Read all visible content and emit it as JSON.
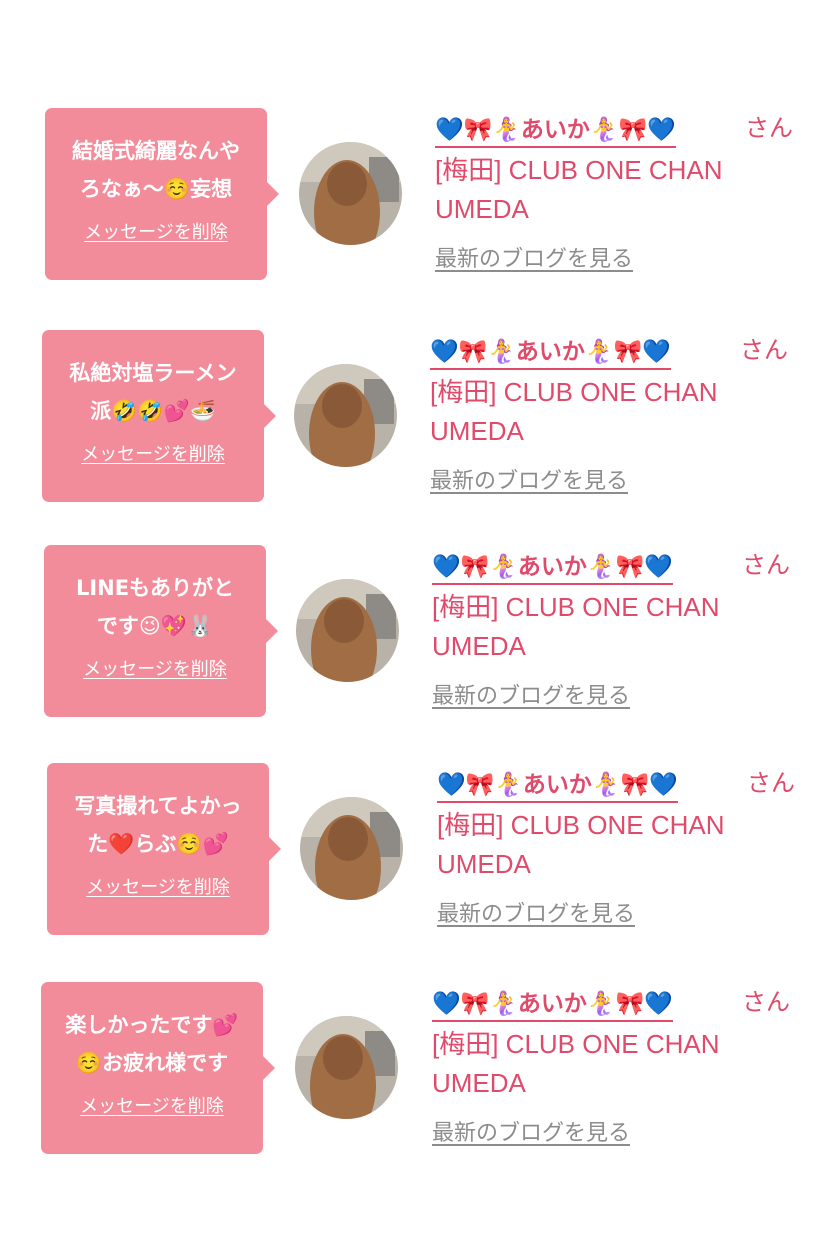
{
  "entries": [
    {
      "message": "結婚式綺麗なんや\nろなぁ〜☺️妄想",
      "delete_label": "メッセージを削除",
      "name": "💙🎀🧜‍♀️あいか🧜‍♀️🎀💙",
      "honorific": "さん",
      "club": "[梅田] CLUB ONE CHAN UMEDA",
      "blog_label": "最新のブログを見る"
    },
    {
      "message": "私絶対塩ラーメン\n派🤣🤣💕🍜",
      "delete_label": "メッセージを削除",
      "name": "💙🎀🧜‍♀️あいか🧜‍♀️🎀💙",
      "honorific": "さん",
      "club": "[梅田] CLUB ONE CHAN UMEDA",
      "blog_label": "最新のブログを見る"
    },
    {
      "message": "LINEもありがと\nです😉💖🐰",
      "delete_label": "メッセージを削除",
      "name": "💙🎀🧜‍♀️あいか🧜‍♀️🎀💙",
      "honorific": "さん",
      "club": "[梅田] CLUB ONE CHAN UMEDA",
      "blog_label": "最新のブログを見る"
    },
    {
      "message": "写真撮れてよかっ\nた❤️らぶ☺️💕",
      "delete_label": "メッセージを削除",
      "name": "💙🎀🧜‍♀️あいか🧜‍♀️🎀💙",
      "honorific": "さん",
      "club": "[梅田] CLUB ONE CHAN UMEDA",
      "blog_label": "最新のブログを見る"
    },
    {
      "message": "楽しかったです💕\n☺️お疲れ様です",
      "delete_label": "メッセージを削除",
      "name": "💙🎀🧜‍♀️あいか🧜‍♀️🎀💙",
      "honorific": "さん",
      "club": "[梅田] CLUB ONE CHAN UMEDA",
      "blog_label": "最新のブログを見る"
    }
  ],
  "colors": {
    "bubble": "#f38c9a",
    "accent": "#e04a6b",
    "link_gray": "#8c8c8c"
  }
}
